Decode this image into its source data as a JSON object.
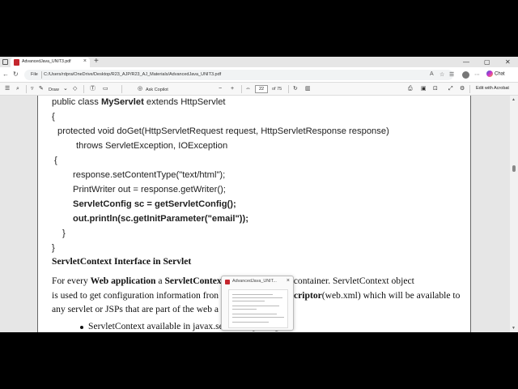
{
  "browser": {
    "tab_title": "AdvancedJava_UNIT3.pdf",
    "new_tab_glyph": "+",
    "address_label": "File",
    "url": "C:/Users/rdpra/OneDrive/Desktop/R23_AJP/R23_AJ_Materials/AdvancedJava_UNIT3.pdf",
    "copilot_label": "Chat",
    "window_controls": [
      "—",
      "▢",
      "✕"
    ]
  },
  "pdf_toolbar": {
    "draw_label": "Draw",
    "ask_copilot_label": "Ask Copilot",
    "zoom_out": "−",
    "zoom_in": "+",
    "page_current": "22",
    "page_total": "of 75",
    "edit_label": "Edit with Acrobat"
  },
  "document": {
    "code_lines": {
      "l1_a": "public class ",
      "l1_b": "MyServlet",
      "l1_c": " extends HttpServlet",
      "l2": "{",
      "l3": "protected void doGet(HttpServletRequest request, HttpServletResponse response)",
      "l4": "throws ServletException, IOException",
      "l5": "{",
      "l6": "response.setContentType(\"text/html\");",
      "l7": "PrintWriter out = response.getWriter();",
      "l8": "ServletConfig sc = getServletConfig();",
      "l9": "out.println(sc.getInitParameter(\"email\"));",
      "l10": "}",
      "l11": "}"
    },
    "heading": "ServletContext Interface in Servlet",
    "para": {
      "p1_a": "For every ",
      "p1_b": "Web application",
      "p1_c": " a ",
      "p1_d": "ServletContex",
      "p1_e": "by the web container. ServletContext object",
      "p2_a": "is used to get configuration information fron",
      "p2_b": "criptor",
      "p2_c": "(web.xml) which will be available to",
      "p3": "any servlet or JSPs that are part of the web a",
      "bullet1": "ServletContext available in javax.servlet.*; package"
    }
  },
  "thumbnail_popup": {
    "title": "AdvancedJava_UNIT..."
  },
  "colors": {
    "pdf_icon": "#c4262e",
    "page_bg": "#ffffff",
    "viewer_bg": "#e6e6e6"
  }
}
